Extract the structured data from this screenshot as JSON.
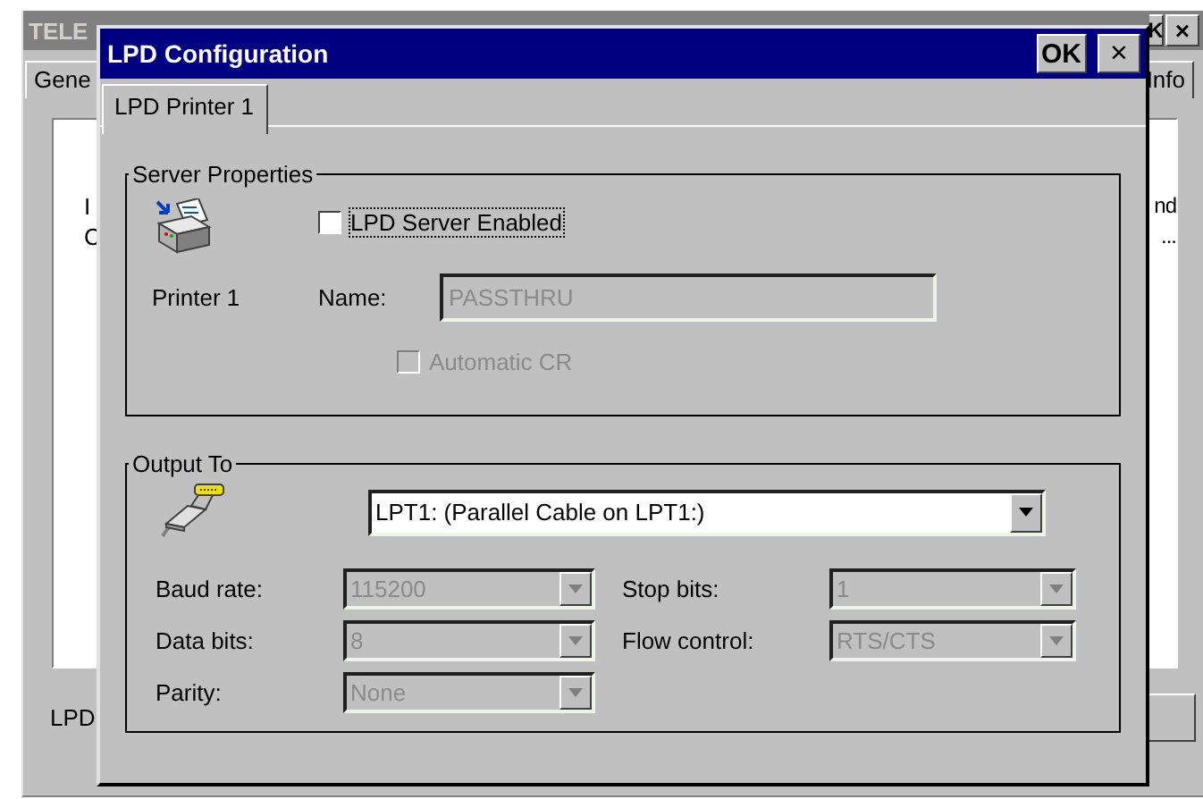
{
  "background_window": {
    "title": "TELE",
    "buttons": [
      "K",
      "×"
    ],
    "tabs": [
      {
        "label": "Gene",
        "selected": false
      },
      {
        "label": "Info",
        "selected": false
      }
    ],
    "left_texts": [
      "I",
      "C"
    ],
    "right_texts": [
      "nd",
      "..."
    ],
    "status_label": "LPD"
  },
  "dialog": {
    "title": "LPD Configuration",
    "ok_button": "OK",
    "close_button": "×",
    "tabs": [
      {
        "label": "LPD Printer 1",
        "selected": true
      }
    ],
    "server_group": {
      "title": "Server Properties",
      "enable": {
        "label": "LPD Server Enabled",
        "checked": false,
        "disabled": false
      },
      "printer_label": "Printer 1",
      "name": {
        "label": "Name:",
        "value": "PASSTHRU",
        "disabled": true
      },
      "automatic_cr": {
        "label": "Automatic CR",
        "checked": false,
        "disabled": true
      }
    },
    "output_group": {
      "title": "Output To",
      "port": {
        "value": "LPT1: (Parallel Cable on LPT1:)",
        "disabled": false
      },
      "settings": [
        {
          "label": "Baud rate:",
          "value": "115200",
          "disabled": true
        },
        {
          "label": "Stop bits:",
          "value": "1",
          "disabled": true
        },
        {
          "label": "Data bits:",
          "value": "8",
          "disabled": true
        },
        {
          "label": "Flow control:",
          "value": "RTS/CTS",
          "disabled": true
        },
        {
          "label": "Parity:",
          "value": "None",
          "disabled": true
        }
      ]
    }
  }
}
